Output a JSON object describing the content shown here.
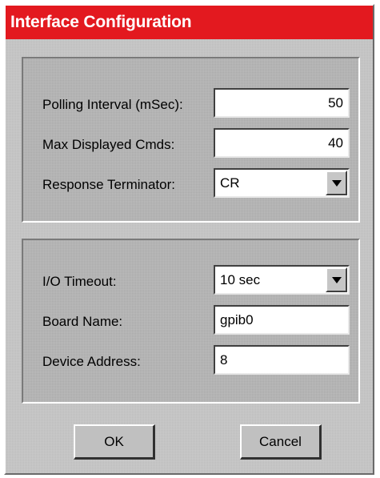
{
  "window": {
    "title": "Interface Configuration"
  },
  "settings": {
    "polling_interval": {
      "label": "Polling Interval (mSec):",
      "value": "50"
    },
    "max_displayed_cmds": {
      "label": "Max Displayed Cmds:",
      "value": "40"
    },
    "response_terminator": {
      "label": "Response Terminator:",
      "value": "CR"
    }
  },
  "gpib": {
    "io_timeout": {
      "label": "I/O Timeout:",
      "value": "10 sec"
    },
    "board_name": {
      "label": "Board Name:",
      "value": "gpib0"
    },
    "device_address": {
      "label": "Device Address:",
      "value": "8"
    }
  },
  "buttons": {
    "ok": "OK",
    "cancel": "Cancel"
  },
  "colors": {
    "titlebar": "#e3191f",
    "title_text": "#ffffff",
    "dialog_face": "#c6c6c6",
    "field_bg": "#ffffff"
  },
  "icons": {
    "dropdown": "chevron-down-icon"
  }
}
